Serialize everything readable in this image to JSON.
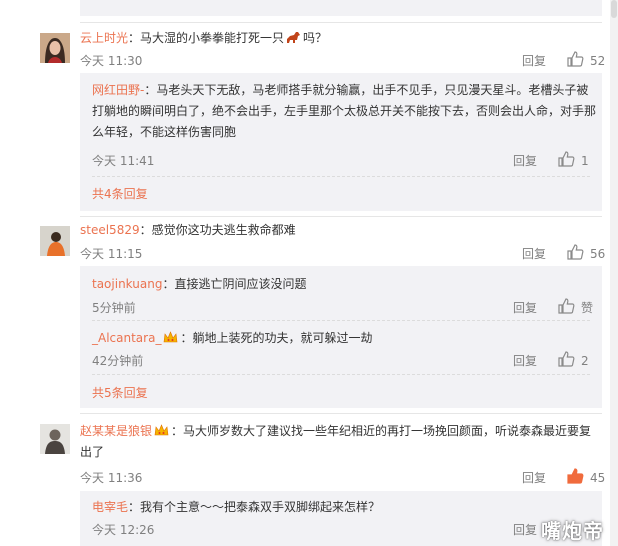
{
  "comments": [
    {
      "name": "云上时光",
      "text_before": "：马大湿的小拳拳能打死一只",
      "emoji_name": "horse-emoji",
      "text_after": "吗？",
      "time": "今天 11:30",
      "reply": "回复",
      "likes": "52",
      "subs": [
        {
          "name": "网红田野-",
          "text": "：马老头天下无敌，马老师搭手就分输赢，出手不见手，只见漫天星斗。老槽头子被打躺地的瞬间明白了，绝不会出手，左手里那个太极总开关不能按下去，否则会出人命，对手那么年轻，不能这样伤害同胞",
          "time": "今天 11:41",
          "reply": "回复",
          "likes": "1"
        }
      ],
      "more": "共4条回复"
    },
    {
      "name": "steel5829",
      "text": "：感觉你这功夫逃生救命都难",
      "time": "今天 11:15",
      "reply": "回复",
      "likes": "56",
      "subs": [
        {
          "name": "taojinkuang",
          "text": "：直接逃亡阴间应该没问题",
          "time": "5分钟前",
          "reply": "回复",
          "likes": "赞"
        },
        {
          "name": "_Alcantara_",
          "badge": "crown-icon",
          "text": "：躺地上装死的功夫，就可躲过一劫",
          "time": "42分钟前",
          "reply": "回复",
          "likes": "2"
        }
      ],
      "more": "共5条回复"
    },
    {
      "name": "赵某某是狼银",
      "badge": "crown-icon",
      "text": "：马大师岁数大了建议找一些年纪相近的再打一场挽回颜面，听说泰森最近要复出了",
      "time": "今天 11:36",
      "reply": "回复",
      "likes": "45",
      "liked": true,
      "subs": [
        {
          "name": "电宰毛",
          "text": "：我有个主意～～把泰森双手双脚绑起来怎样？",
          "time": "今天 12:26",
          "reply": "回复",
          "likes": ""
        }
      ]
    }
  ],
  "watermark": "嘴炮帝",
  "colors": {
    "name": "#eb7350",
    "meta": "#808080",
    "sub_bg": "#f2f2f5",
    "liked": "#f06b3d"
  }
}
